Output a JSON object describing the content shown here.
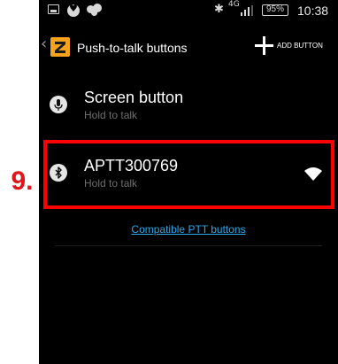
{
  "annotation": {
    "step_label": "9."
  },
  "status_bar": {
    "network_type": "4G",
    "battery_percent": "95%",
    "time": "10:38",
    "icons": [
      "screenshot-icon",
      "heart-icon",
      "chat-bubbles-icon",
      "bluetooth-icon",
      "signal-icon",
      "battery-icon"
    ]
  },
  "action_bar": {
    "title": "Push-to-talk buttons",
    "add_button_label": "ADD BUTTON",
    "icons": [
      "back-chevron-icon",
      "zello-logo-icon",
      "plus-icon"
    ]
  },
  "buttons_list": [
    {
      "name": "Screen button",
      "subtitle": "Hold to talk",
      "icon": "microphone-icon"
    },
    {
      "name": "APTT300769",
      "subtitle": "Hold to talk",
      "icon": "bluetooth-icon",
      "status_icon": "wifi-signal-icon"
    }
  ],
  "links": {
    "compatible": "Compatible PTT buttons"
  },
  "colors": {
    "background": "#000000",
    "accent_link": "#2ea8e6",
    "highlight": "#ff0000",
    "logo": "#f5a21d",
    "step_label": "#e0161b"
  }
}
